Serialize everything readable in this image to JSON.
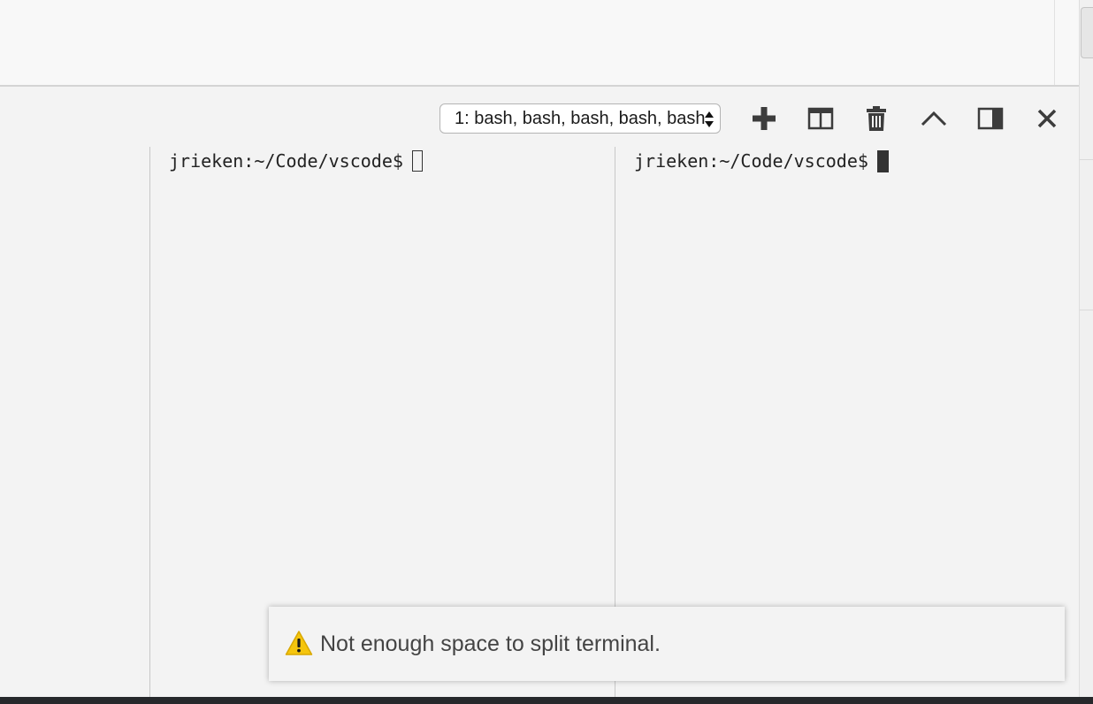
{
  "terminal_panel": {
    "selected_terminal": "1: bash, bash, bash, bash, bash",
    "toolbar": {
      "new_terminal_icon": "plus-icon",
      "split_terminal_icon": "split-icon",
      "kill_terminal_icon": "trash-icon",
      "maximize_panel_icon": "chevron-up-icon",
      "toggle_panel_position_icon": "panel-right-icon",
      "close_panel_icon": "close-icon"
    },
    "panes": [
      {
        "prompt": "jrieken:~/Code/vscode$",
        "focused": false
      },
      {
        "prompt": "jrieken:~/Code/vscode$",
        "focused": true
      }
    ]
  },
  "notification": {
    "severity": "warning",
    "icon": "warning-icon",
    "message": "Not enough space to split terminal."
  },
  "colors": {
    "panel_background": "#f3f3f3",
    "status_bar": "#26282b",
    "warning_yellow": "#f5c50d"
  }
}
